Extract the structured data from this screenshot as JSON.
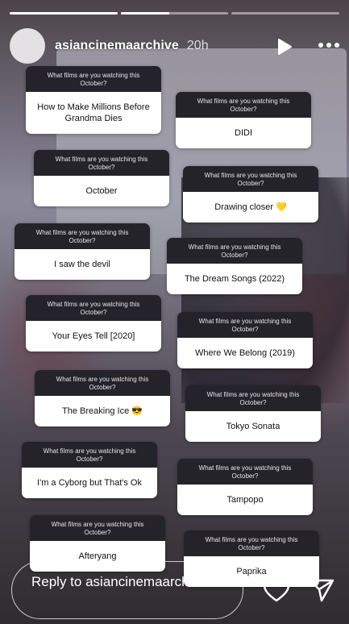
{
  "story": {
    "progress_segments": [
      1.0,
      0.45,
      0.0
    ]
  },
  "header": {
    "username": "asiancinemaarchive",
    "time": "20h",
    "icons": [
      "avatar",
      "play-icon",
      "more-icon"
    ]
  },
  "cards": [
    {
      "question": "What films are you watching this October?",
      "answer": "How to Make Millions Before Grandma Dies"
    },
    {
      "question": "What films are you watching this October?",
      "answer": "DIDI"
    },
    {
      "question": "What films are you watching this October?",
      "answer": "October"
    },
    {
      "question": "What films are you watching this October?",
      "answer": "Drawing closer 💛"
    },
    {
      "question": "What films are you watching this October?",
      "answer": "I saw the devil"
    },
    {
      "question": "What films are you watching this October?",
      "answer": "The Dream Songs (2022)"
    },
    {
      "question": "What films are you watching this October?",
      "answer": "Your Eyes Tell [2020]"
    },
    {
      "question": "What films are you watching this October?",
      "answer": "Where We Belong (2019)"
    },
    {
      "question": "What films are you watching this October?",
      "answer": "The Breaking Ice 😎"
    },
    {
      "question": "What films are you watching this October?",
      "answer": "Tokyo Sonata"
    },
    {
      "question": "What films are you watching this October?",
      "answer": "I'm a Cyborg but That's Ok"
    },
    {
      "question": "What films are you watching this October?",
      "answer": "Tampopo"
    },
    {
      "question": "What films are you watching this October?",
      "answer": "Afteryang"
    },
    {
      "question": "What films are you watching this October?",
      "answer": "Paprika"
    }
  ],
  "footer": {
    "reply_text": "Reply to asiancinemaarchive...",
    "icons": [
      "heart-icon",
      "send-icon"
    ]
  }
}
